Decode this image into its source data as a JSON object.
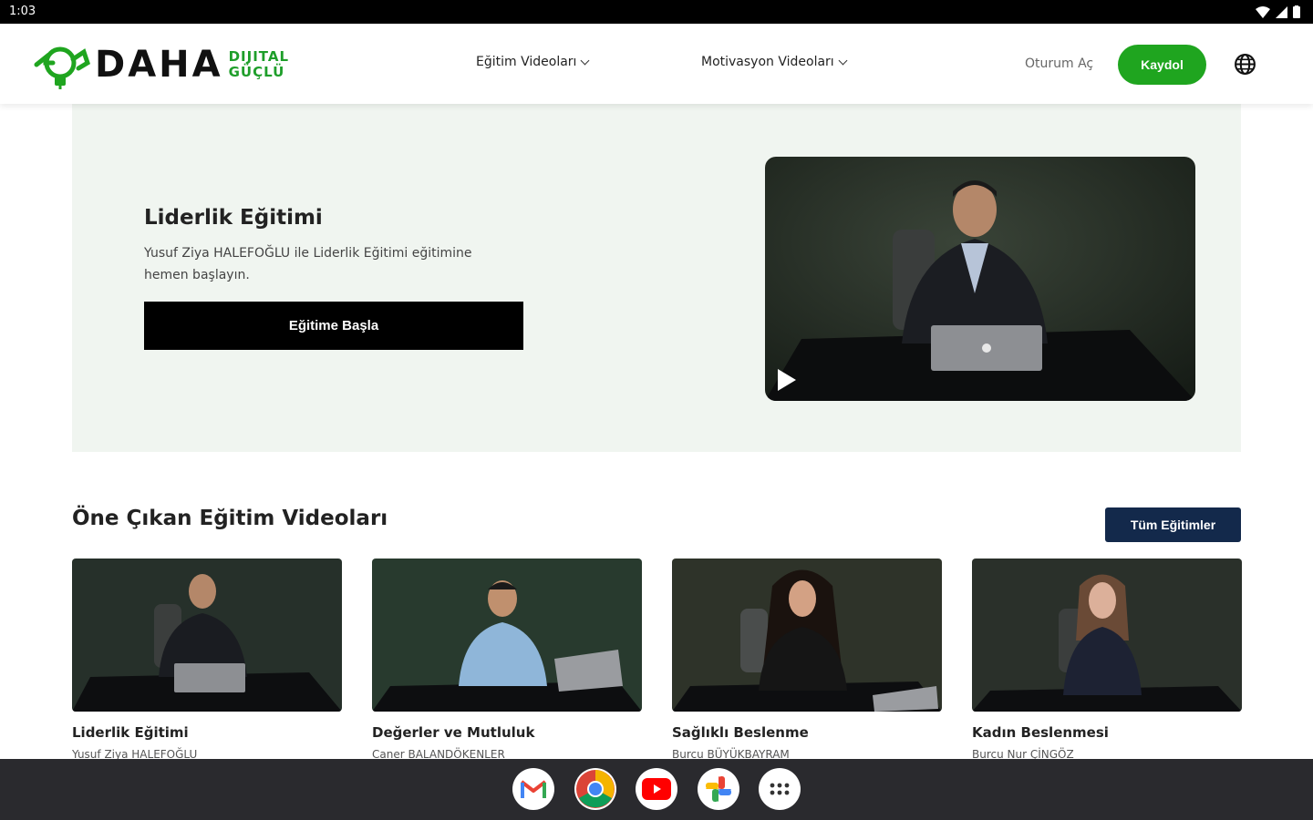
{
  "status_bar": {
    "time": "1:03"
  },
  "brand": {
    "name": "DAHA",
    "sub_line1": "DIJITAL",
    "sub_line2": "GÜÇLÜ",
    "accent": "#1fa51f"
  },
  "nav": {
    "items": [
      {
        "label": "Eğitim Videoları"
      },
      {
        "label": "Motivasyon Videoları"
      }
    ],
    "login_label": "Oturum Aç",
    "signup_label": "Kaydol"
  },
  "hero": {
    "title": "Liderlik Eğitimi",
    "description": "Yusuf Ziya HALEFOĞLU ile Liderlik Eğitimi eğitimine hemen başlayın.",
    "button_label": "Eğitime Başla"
  },
  "featured": {
    "title": "Öne Çıkan Eğitim Videoları",
    "all_button_label": "Tüm Eğitimler",
    "cards": [
      {
        "title": "Liderlik Eğitimi",
        "author": "Yusuf Ziya HALEFOĞLU"
      },
      {
        "title": "Değerler ve Mutluluk",
        "author": "Caner BALANDÖKENLER"
      },
      {
        "title": "Sağlıklı Beslenme",
        "author": "Burcu BÜYÜKBAYRAM"
      },
      {
        "title": "Kadın Beslenmesi",
        "author": "Burcu Nur ÇİNGÖZ"
      }
    ]
  },
  "taskbar": {
    "apps": [
      {
        "icon": "gmail-icon"
      },
      {
        "icon": "chrome-icon"
      },
      {
        "icon": "youtube-icon"
      },
      {
        "icon": "photos-icon"
      },
      {
        "icon": "app-drawer-icon"
      }
    ]
  }
}
